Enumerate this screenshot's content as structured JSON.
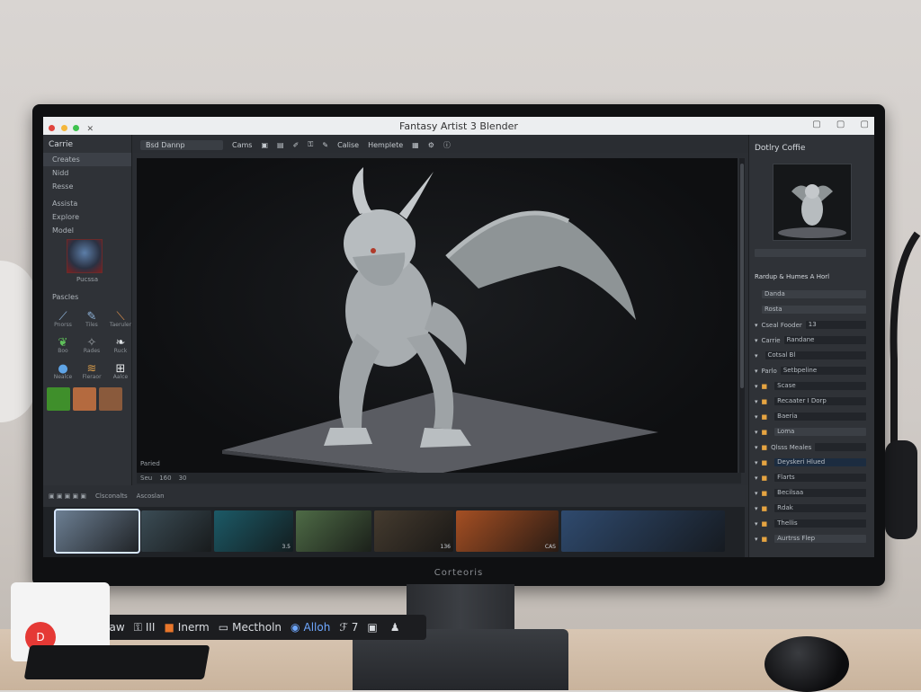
{
  "monitor": {
    "brand": "Corteoris"
  },
  "window": {
    "title": "Fantasy Artist 3 Blender",
    "ctrl_icons": [
      "minimize-icon",
      "maximize-icon",
      "close-icon"
    ]
  },
  "left_panel": {
    "title": "Carrie",
    "items": [
      "Creates",
      "Nidd",
      "Resse",
      "Assista",
      "Explore",
      "Model"
    ],
    "thumb_label": "Pucssa",
    "brush_header": "Pascles",
    "brushes": [
      {
        "label": "Pnorss",
        "icon": "knife-icon"
      },
      {
        "label": "Tiles",
        "icon": "pen-icon"
      },
      {
        "label": "Taeruler",
        "icon": "brush-icon"
      },
      {
        "label": "Boo",
        "icon": "leaf-icon"
      },
      {
        "label": "Rades",
        "icon": "figure-icon"
      },
      {
        "label": "Ruck",
        "icon": "feather-icon"
      },
      {
        "label": "Nealce",
        "icon": "sphere-icon"
      },
      {
        "label": "Fleraor",
        "icon": "claw-icon"
      },
      {
        "label": "Aalce",
        "icon": "mesh-icon"
      }
    ],
    "swatches": [
      "#3f8f2b",
      "#b46a3f",
      "#8a5a3c"
    ]
  },
  "toolbar": {
    "search_value": "Bsd Dannp",
    "items": [
      "Cams",
      "Calise",
      "Hemplete"
    ]
  },
  "viewport": {
    "label": "Paried"
  },
  "status": [
    "Seu",
    "160",
    "30"
  ],
  "filmstrip": {
    "bar_labels": [
      "Clsconalts",
      "Ascoslan"
    ],
    "frames": [
      {
        "num": "",
        "color": "#6c7f93",
        "selected": true,
        "width": 92
      },
      {
        "num": "",
        "color": "#3b4c55",
        "selected": false,
        "width": 78
      },
      {
        "num": "3.5",
        "color": "#1c5a67",
        "selected": false,
        "width": 88
      },
      {
        "num": "",
        "color": "#4e6b46",
        "selected": false,
        "width": 84
      },
      {
        "num": "136",
        "color": "#453b2f",
        "selected": false,
        "width": 88
      },
      {
        "num": "CAS",
        "color": "#a54f23",
        "selected": false,
        "width": 114
      },
      {
        "num": "",
        "color": "#2f4a6e",
        "selected": false,
        "width": 182
      }
    ]
  },
  "right_panel": {
    "title": "Dotlry Coffie",
    "tabs": "Rardup & Humes  A Horl",
    "rows": [
      {
        "label": "",
        "value": "Danda",
        "kind": "light"
      },
      {
        "label": "",
        "value": "Rosta",
        "kind": "light"
      },
      {
        "label": "Cseal Fooder",
        "value": "13",
        "kind": "dark"
      },
      {
        "label": "Carrie",
        "value": "Randane",
        "kind": "dark"
      },
      {
        "label": "",
        "value": "Cotsal Bl",
        "kind": "dark"
      },
      {
        "label": "Parlo",
        "value": "Setbpeline",
        "kind": "dark"
      },
      {
        "label": "",
        "value": "Scase",
        "kind": "dark"
      },
      {
        "label": "",
        "value": "Recaater I Dorp",
        "kind": "dark"
      },
      {
        "label": "",
        "value": "Baeria",
        "kind": "dark"
      },
      {
        "label": "",
        "value": "Loma",
        "kind": "light"
      },
      {
        "label": "Qlsss Meales",
        "value": "",
        "kind": "dark"
      },
      {
        "label": "",
        "value": "Deyskeri Hlued",
        "kind": "blue"
      },
      {
        "label": "",
        "value": "Flarts",
        "kind": "dark"
      },
      {
        "label": "",
        "value": "Becilsaa",
        "kind": "dark"
      },
      {
        "label": "",
        "value": "Rdak",
        "kind": "dark"
      },
      {
        "label": "",
        "value": "Thellis",
        "kind": "dark"
      },
      {
        "label": "",
        "value": "Aurtrss Flep",
        "kind": "light"
      }
    ]
  },
  "dock": {
    "items": [
      {
        "icon": "circle-icon",
        "label": "Haw"
      },
      {
        "icon": "lock-icon",
        "label": "III"
      },
      {
        "icon": "orange-square-icon",
        "label": "Inerm"
      },
      {
        "icon": "chat-icon",
        "label": "Mectholn"
      },
      {
        "icon": "globe-icon",
        "label": "Alloh"
      },
      {
        "icon": "fork-icon",
        "label": "7"
      },
      {
        "icon": "window-icon",
        "label": ""
      },
      {
        "icon": "mic-icon",
        "label": ""
      }
    ]
  }
}
